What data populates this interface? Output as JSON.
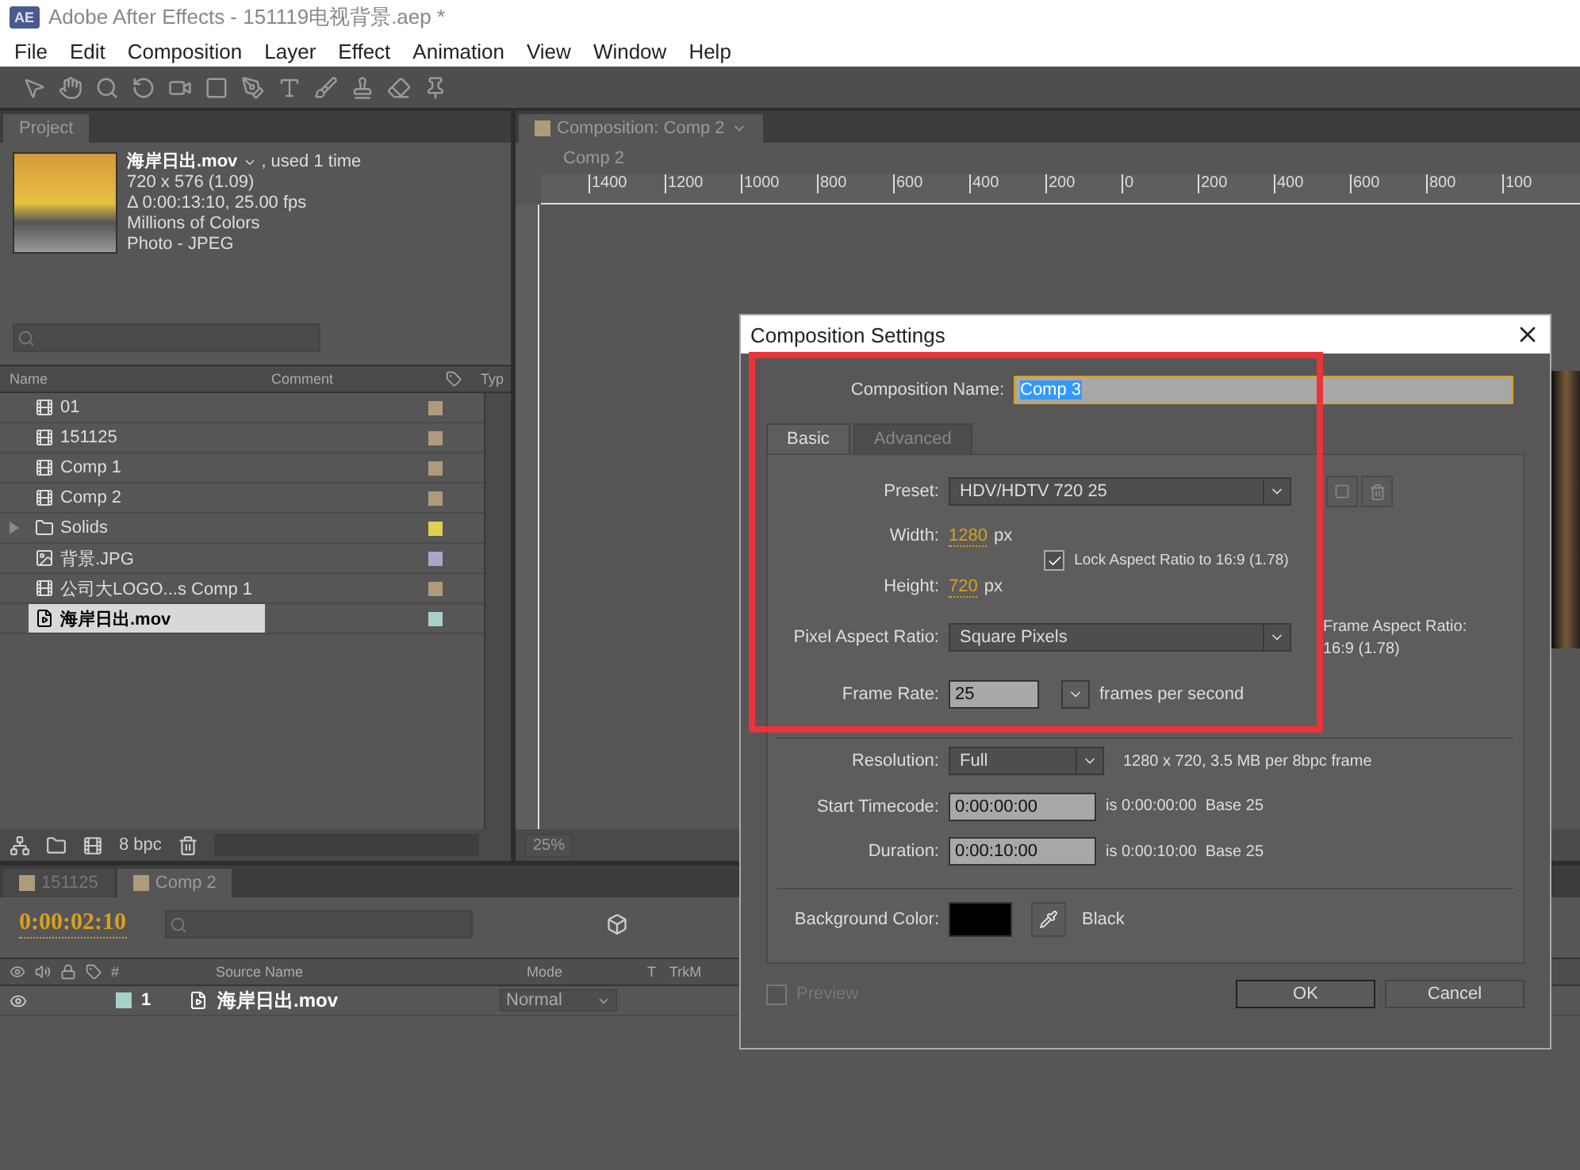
{
  "window": {
    "badge": "AE",
    "title": "Adobe After Effects - 151119电视背景.aep *"
  },
  "menu": [
    "File",
    "Edit",
    "Composition",
    "Layer",
    "Effect",
    "Animation",
    "View",
    "Window",
    "Help"
  ],
  "project_panel": {
    "tab": "Project",
    "preview": {
      "name": "海岸日出.mov",
      "usage": ", used 1 time",
      "details": [
        "720 x 576 (1.09)",
        "Δ 0:00:13:10, 25.00 fps",
        "Millions of Colors",
        "Photo - JPEG"
      ]
    },
    "columns": [
      "Name",
      "Comment",
      "Typ"
    ],
    "items": [
      {
        "kind": "comp",
        "name": "01",
        "color": "#b09a7c",
        "selected": false
      },
      {
        "kind": "comp",
        "name": "151125",
        "color": "#b09a7c",
        "selected": false
      },
      {
        "kind": "comp",
        "name": "Comp 1",
        "color": "#b09a7c",
        "selected": false
      },
      {
        "kind": "comp",
        "name": "Comp 2",
        "color": "#b09a7c",
        "selected": false
      },
      {
        "kind": "folder",
        "name": "Solids",
        "color": "#e0d050",
        "selected": false
      },
      {
        "kind": "image",
        "name": "背景.JPG",
        "color": "#a8a8c8",
        "selected": false
      },
      {
        "kind": "comp",
        "name": "公司大LOGO...s Comp 1",
        "color": "#b09a7c",
        "selected": false
      },
      {
        "kind": "footage",
        "name": "海岸日出.mov",
        "color": "#a8d0c8",
        "selected": true
      }
    ],
    "bpc": "8 bpc"
  },
  "comp_panel": {
    "tab": "Composition: Comp 2",
    "breadcrumb": "Comp 2",
    "ruler": [
      "1400",
      "1200",
      "1000",
      "800",
      "600",
      "400",
      "200",
      "0",
      "200",
      "400",
      "600",
      "800",
      "100"
    ],
    "zoom": "25%"
  },
  "timeline": {
    "tabs": [
      {
        "label": "151125",
        "selected": false
      },
      {
        "label": "Comp 2",
        "selected": true
      }
    ],
    "timecode": "0:00:02:10",
    "columns": [
      "#",
      "Source Name",
      "Mode",
      "T",
      "TrkM"
    ],
    "layers": [
      {
        "number": "1",
        "name": "海岸日出.mov",
        "mode": "Normal",
        "color": "#a8d0c8"
      }
    ]
  },
  "dialog": {
    "title": "Composition Settings",
    "name_label": "Composition Name:",
    "name_value": "Comp 3",
    "tabs": [
      {
        "label": "Basic",
        "selected": true
      },
      {
        "label": "Advanced",
        "selected": false
      }
    ],
    "preset": {
      "label": "Preset:",
      "value": "HDV/HDTV 720 25"
    },
    "width": {
      "label": "Width:",
      "value": "1280",
      "unit": "px"
    },
    "height": {
      "label": "Height:",
      "value": "720",
      "unit": "px"
    },
    "lock_aspect": {
      "label": "Lock Aspect Ratio to 16:9 (1.78)",
      "checked": true
    },
    "pixel_aspect": {
      "label": "Pixel Aspect Ratio:",
      "value": "Square Pixels",
      "info": [
        "Frame Aspect Ratio:",
        "16:9 (1.78)"
      ]
    },
    "frame_rate": {
      "label": "Frame Rate:",
      "value": "25",
      "unit": "frames per second"
    },
    "resolution": {
      "label": "Resolution:",
      "value": "Full",
      "info": "1280 x 720, 3.5 MB per 8bpc frame"
    },
    "start_timecode": {
      "label": "Start Timecode:",
      "value": "0:00:00:00",
      "info": "is 0:00:00:00  Base 25"
    },
    "duration": {
      "label": "Duration:",
      "value": "0:00:10:00",
      "info": "is 0:00:10:00  Base 25"
    },
    "background": {
      "label": "Background Color:",
      "color": "#000000",
      "name": "Black"
    },
    "preview": {
      "label": "Preview",
      "checked": false,
      "disabled": true
    },
    "buttons": [
      "OK",
      "Cancel"
    ]
  }
}
